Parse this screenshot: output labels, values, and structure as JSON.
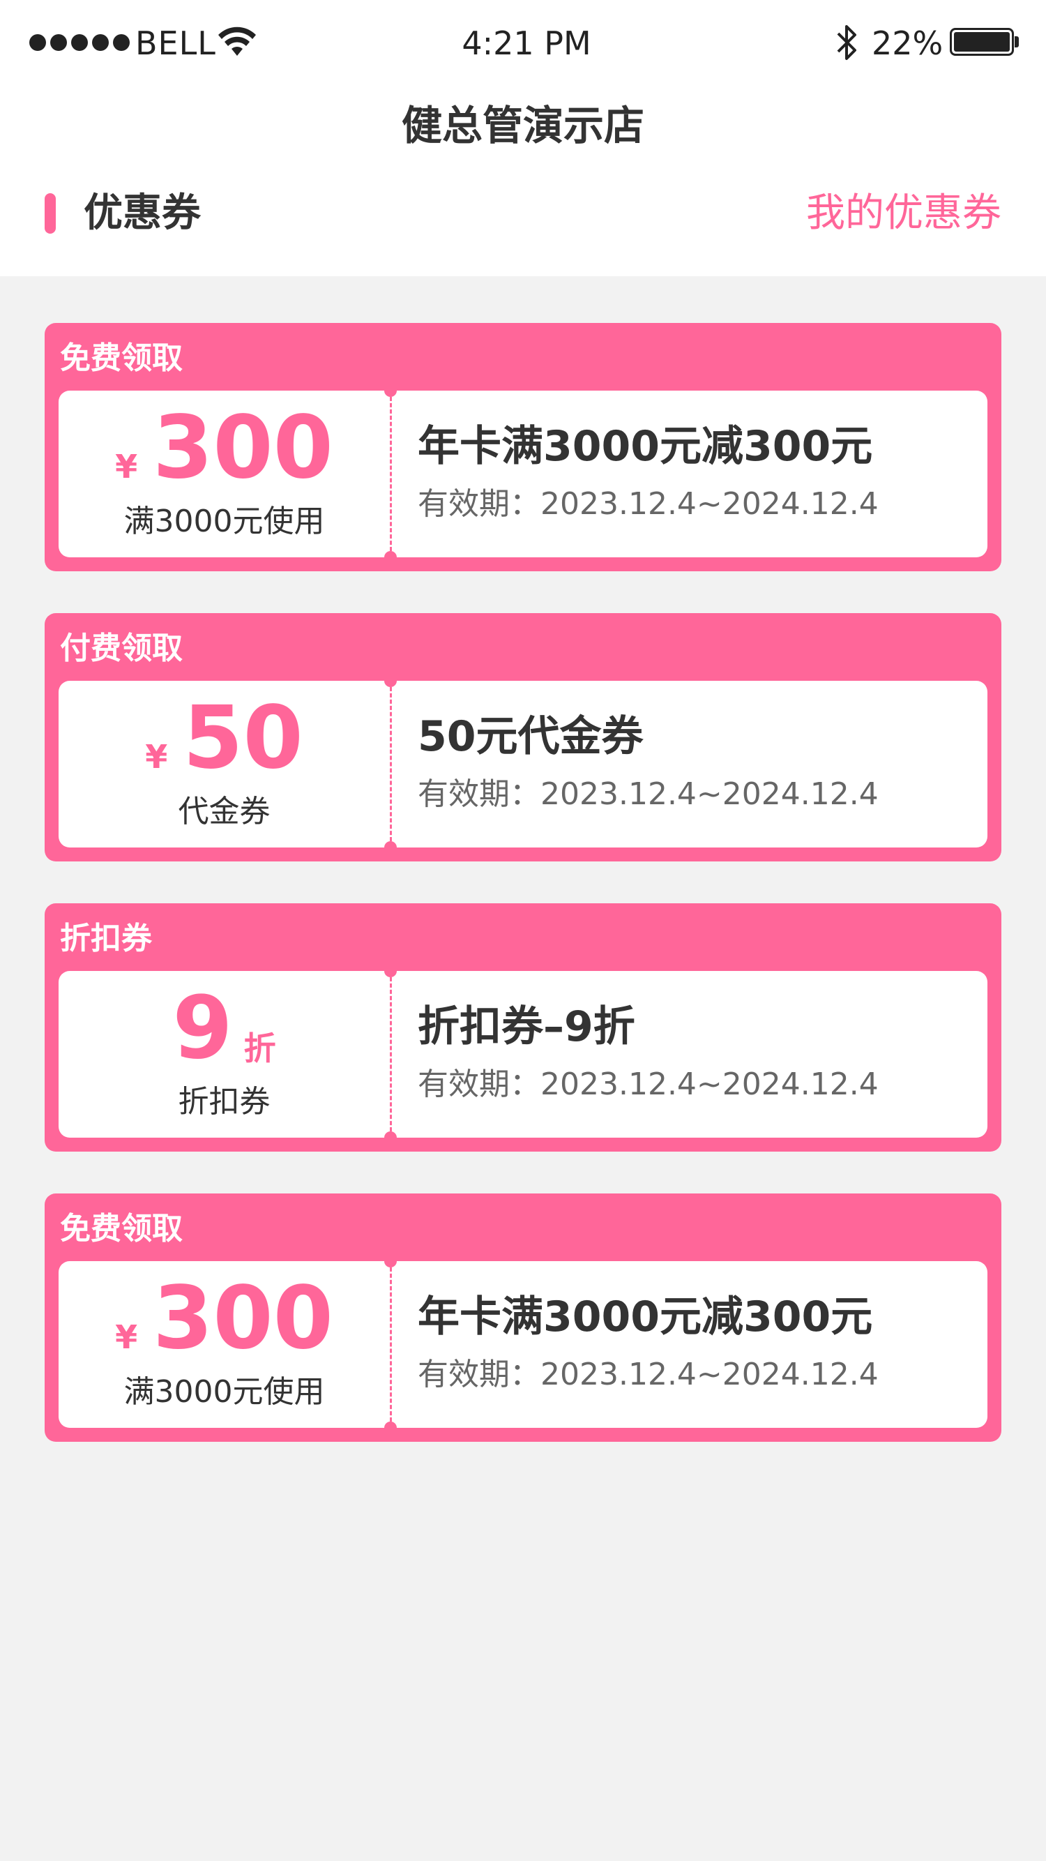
{
  "status_bar": {
    "carrier": "BELL",
    "time": "4:21 PM",
    "battery_percent": "22%",
    "icons": [
      "signal-dots",
      "wifi-icon",
      "bluetooth-icon",
      "battery-icon"
    ]
  },
  "nav": {
    "title": "健总管演示店"
  },
  "section": {
    "title": "优惠券",
    "my_coupons_link": "我的优惠券"
  },
  "colors": {
    "accent": "#ff6699",
    "background": "#f2f2f2",
    "card_body": "#ffffff",
    "text_primary": "#333333",
    "text_secondary": "#666666"
  },
  "coupons": [
    {
      "tag": "免费领取",
      "currency": "¥",
      "amount": "300",
      "condition": "满3000元使用",
      "title": "年卡满3000元减300元",
      "validity": "有效期：2023.12.4~2024.12.4"
    },
    {
      "tag": "付费领取",
      "currency": "¥",
      "amount": "50",
      "condition": "代金券",
      "title": "50元代金券",
      "validity": "有效期：2023.12.4~2024.12.4"
    },
    {
      "tag": "折扣券",
      "amount": "9",
      "unit": "折",
      "condition": "折扣券",
      "title": "折扣券–9折",
      "validity": "有效期：2023.12.4~2024.12.4"
    },
    {
      "tag": "免费领取",
      "currency": "¥",
      "amount": "300",
      "condition": "满3000元使用",
      "title": "年卡满3000元减300元",
      "validity": "有效期：2023.12.4~2024.12.4"
    }
  ]
}
